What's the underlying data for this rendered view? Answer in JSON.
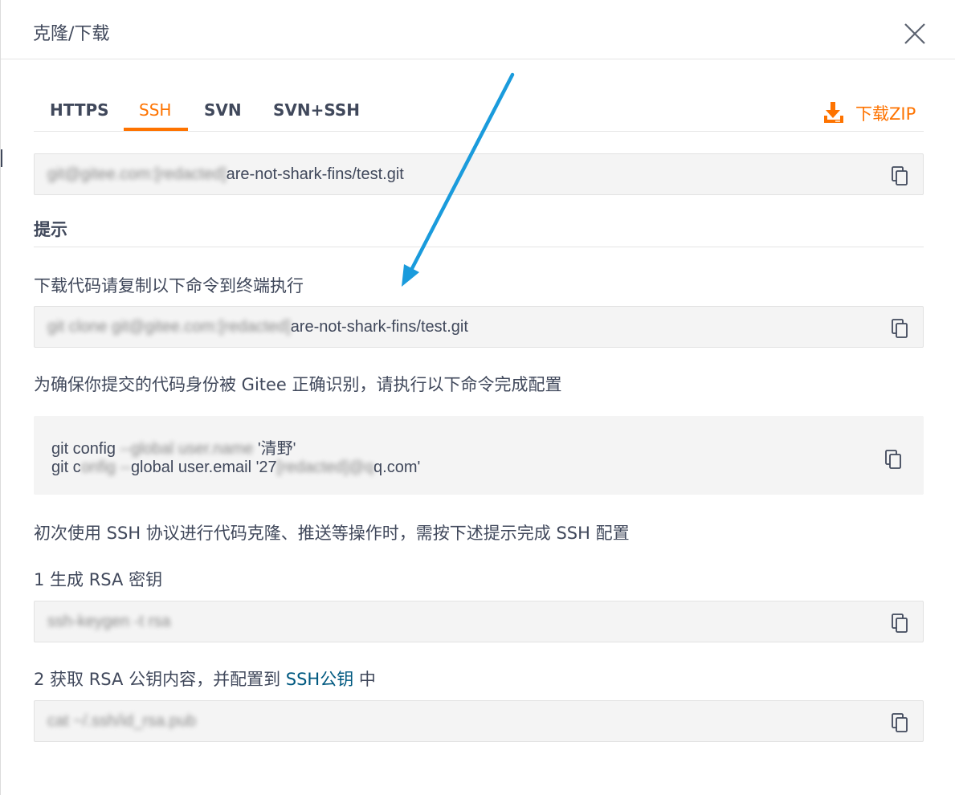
{
  "dialog": {
    "title": "克隆/下载"
  },
  "tabs": [
    {
      "label": "HTTPS",
      "active": false
    },
    {
      "label": "SSH",
      "active": true
    },
    {
      "label": "SVN",
      "active": false
    },
    {
      "label": "SVN+SSH",
      "active": false
    }
  ],
  "download_zip": {
    "label": "下载ZIP"
  },
  "url_field": {
    "blurred_text": "git@gitee.com:[redacted]",
    "visible_text": "are-not-shark-fins/test.git"
  },
  "tips": {
    "title": "提示",
    "clone_instruction": "下载代码请复制以下命令到终端执行",
    "clone_command": {
      "blurred_text": "git clone git@gitee.com:[redacted]",
      "visible_text": "are-not-shark-fins/test.git"
    },
    "identity_instruction": "为确保你提交的代码身份被 Gitee 正确识别，请执行以下命令完成配置",
    "config_commands": [
      {
        "prefix": "git config",
        "blurred": " --global user.name ",
        "suffix": "'清野'"
      },
      {
        "prefix": "git c",
        "blurred": "onfig --",
        "middle": "global user.email '27",
        "blurred2": "[redacted]@q",
        "suffix": "q.com'"
      }
    ],
    "ssh_instruction": "初次使用 SSH 协议进行代码克隆、推送等操作时，需按下述提示完成 SSH 配置",
    "step1_label": "1 生成 RSA 密钥",
    "step1_command": {
      "blurred_text": "ssh-keygen -t rsa"
    },
    "step2_prefix": "2 获取 RSA 公钥内容，并配置到 ",
    "step2_link": "SSH公钥",
    "step2_suffix": " 中",
    "step2_command": {
      "blurred_text": "cat ~/.ssh/id_rsa.pub"
    }
  },
  "colors": {
    "accent": "#fe7300",
    "link": "#005980",
    "annotation_arrow": "#1a9bdc",
    "field_bg": "#f4f4f4"
  }
}
